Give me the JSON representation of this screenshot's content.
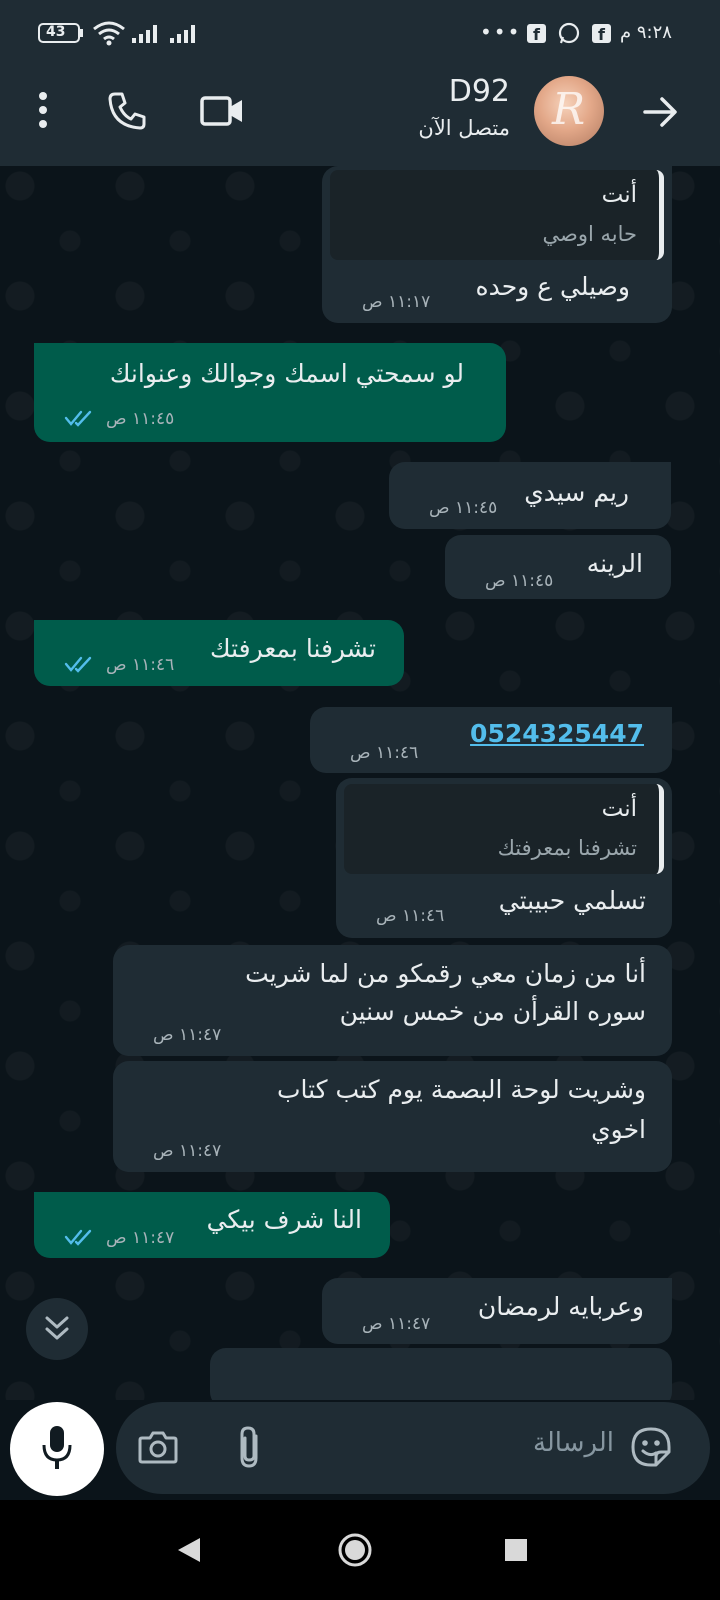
{
  "status_bar": {
    "battery": "43",
    "time": "٩:٢٨ م",
    "more": "•••"
  },
  "header": {
    "contact_name": "D92",
    "status": "متصل الآن"
  },
  "messages": [
    {
      "direction": "in",
      "quoted": {
        "name": "أنت",
        "text": "حابه اوصي"
      },
      "text": "وصيلي ع وحده",
      "time": "١١:١٧ ص"
    },
    {
      "direction": "out",
      "text": "لو سمحتي اسمك وجوالك وعنوانك",
      "time": "١١:٤٥ ص"
    },
    {
      "direction": "in",
      "text": "ريم سيدي",
      "time": "١١:٤٥ ص"
    },
    {
      "direction": "in",
      "text": "الرينه",
      "time": "١١:٤٥ ص"
    },
    {
      "direction": "out",
      "text": "تشرفنا بمعرفتك",
      "time": "١١:٤٦ ص"
    },
    {
      "direction": "in",
      "text": "0524325447",
      "time": "١١:٤٦ ص"
    },
    {
      "direction": "in",
      "quoted": {
        "name": "أنت",
        "text": "تشرفنا بمعرفتك"
      },
      "text": "تسلمي حبيبتي",
      "time": "١١:٤٦ ص"
    },
    {
      "direction": "in",
      "lines": [
        "أنا من زمان معي رقمكو من لما شريت",
        "سوره القرأن من خمس سنين"
      ],
      "time": "١١:٤٧ ص"
    },
    {
      "direction": "in",
      "lines": [
        "وشريت لوحة البصمة يوم كتب كتاب",
        "اخوي"
      ],
      "time": "١١:٤٧ ص"
    },
    {
      "direction": "out",
      "text": "النا شرف بيكي",
      "time": "١١:٤٧ ص"
    },
    {
      "direction": "in",
      "text": "وعربايه لرمضان",
      "time": "١١:٤٧ ص"
    }
  ],
  "composer": {
    "placeholder": "الرسالة"
  },
  "colors": {
    "outgoing_bubble": "#005c4b",
    "incoming_bubble": "#1f2c34",
    "read_ticks": "#53bdeb",
    "background": "#0b141a"
  },
  "icons": [
    "back-arrow-icon",
    "voice-call-icon",
    "video-call-icon",
    "more-options-icon",
    "camera-icon",
    "attach-icon",
    "sticker-icon",
    "mic-icon",
    "scroll-down-icon"
  ]
}
